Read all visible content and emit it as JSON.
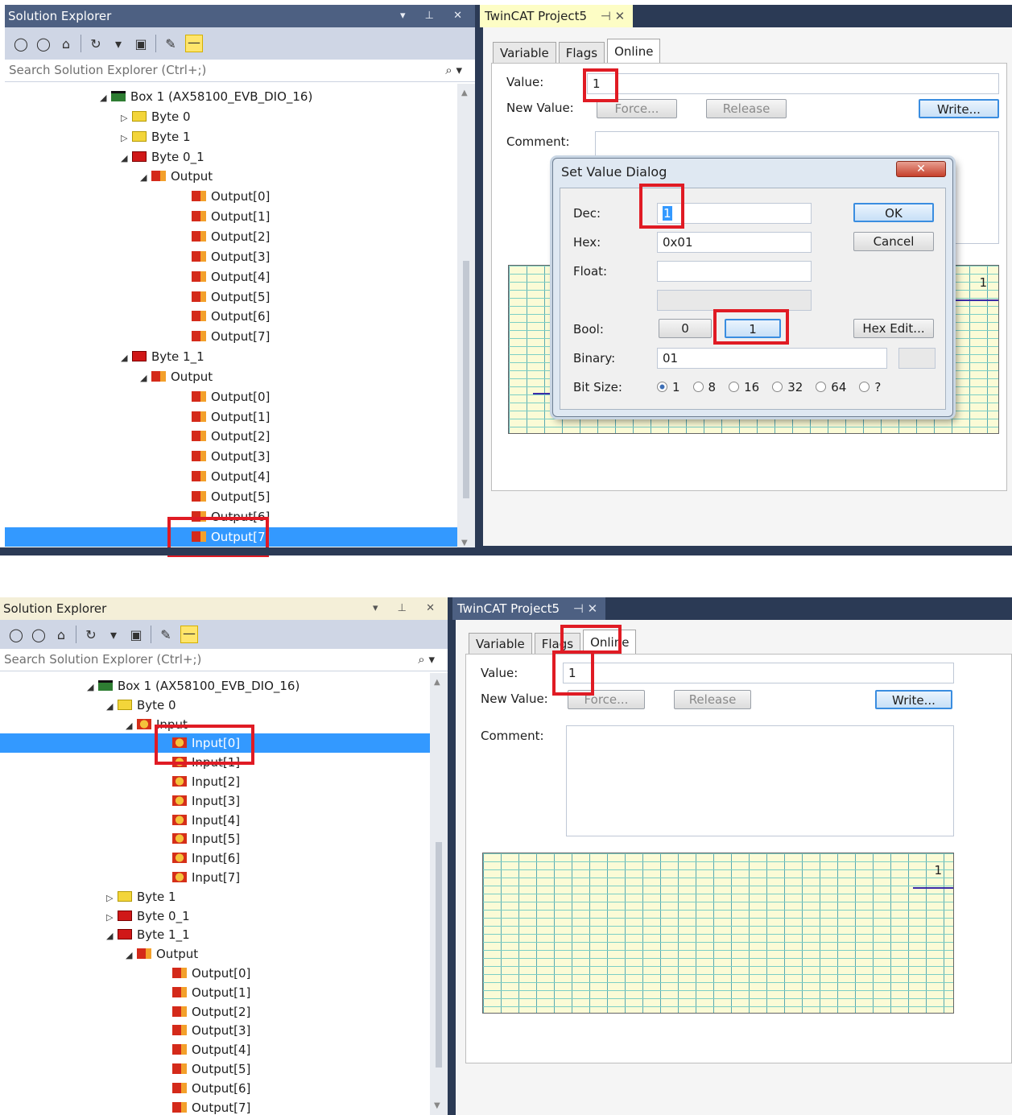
{
  "top": {
    "explorer": {
      "title": "Solution Explorer",
      "title_controls": "▾ ⊥ ✕",
      "search_placeholder": "Search Solution Explorer (Ctrl+;)",
      "tree": [
        {
          "label": "Box 1 (AX58100_EVB_DIO_16)",
          "icon": "device-icon",
          "toggle": "◢"
        },
        {
          "label": "Byte 0",
          "icon": "byte-icon",
          "toggle": "▷"
        },
        {
          "label": "Byte 1",
          "icon": "byte-icon",
          "toggle": "▷"
        },
        {
          "label": "Byte 0_1",
          "icon": "byte-output-icon",
          "toggle": "◢"
        },
        {
          "label": "Output",
          "icon": "output-folder-icon",
          "toggle": "◢"
        },
        {
          "label": "Output[0]",
          "icon": "output-icon"
        },
        {
          "label": "Output[1]",
          "icon": "output-icon"
        },
        {
          "label": "Output[2]",
          "icon": "output-icon"
        },
        {
          "label": "Output[3]",
          "icon": "output-icon"
        },
        {
          "label": "Output[4]",
          "icon": "output-icon"
        },
        {
          "label": "Output[5]",
          "icon": "output-icon"
        },
        {
          "label": "Output[6]",
          "icon": "output-icon"
        },
        {
          "label": "Output[7]",
          "icon": "output-icon"
        },
        {
          "label": "Byte 1_1",
          "icon": "byte-output-icon",
          "toggle": "◢"
        },
        {
          "label": "Output",
          "icon": "output-folder-icon",
          "toggle": "◢"
        },
        {
          "label": "Output[0]",
          "icon": "output-icon"
        },
        {
          "label": "Output[1]",
          "icon": "output-icon"
        },
        {
          "label": "Output[2]",
          "icon": "output-icon"
        },
        {
          "label": "Output[3]",
          "icon": "output-icon"
        },
        {
          "label": "Output[4]",
          "icon": "output-icon"
        },
        {
          "label": "Output[5]",
          "icon": "output-icon"
        },
        {
          "label": "Output[6]",
          "icon": "output-icon"
        },
        {
          "label": "Output[7]",
          "icon": "output-icon",
          "selected": true
        }
      ]
    },
    "doc": {
      "tab_title": "TwinCAT Project5",
      "tab_controls": "⊣ ✕",
      "tabs": [
        "Variable",
        "Flags",
        "Online"
      ],
      "active_tab": "Online",
      "value_label": "Value:",
      "value": "1",
      "new_value_label": "New Value:",
      "force_label": "Force...",
      "release_label": "Release",
      "write_label": "Write...",
      "comment_label": "Comment:",
      "graph_value": "1"
    },
    "dialog": {
      "title": "Set Value Dialog",
      "close_label": "✕",
      "dec_label": "Dec:",
      "dec_value": "1",
      "hex_label": "Hex:",
      "hex_value": "0x01",
      "float_label": "Float:",
      "float_value": "",
      "bool_label": "Bool:",
      "bool_0": "0",
      "bool_1": "1",
      "binary_label": "Binary:",
      "binary_value": "01",
      "bitsize_label": "Bit Size:",
      "bitsizes": [
        "1",
        "8",
        "16",
        "32",
        "64",
        "?"
      ],
      "bitsize_selected": "1",
      "ok_label": "OK",
      "cancel_label": "Cancel",
      "hexedit_label": "Hex Edit..."
    }
  },
  "bottom": {
    "explorer": {
      "title": "Solution Explorer",
      "title_controls": "▾ ⊥ ✕",
      "search_placeholder": "Search Solution Explorer (Ctrl+;)",
      "tree": [
        {
          "label": "Box 1 (AX58100_EVB_DIO_16)",
          "icon": "device-icon",
          "toggle": "◢"
        },
        {
          "label": "Byte 0",
          "icon": "byte-icon",
          "toggle": "◢"
        },
        {
          "label": "Input",
          "icon": "input-folder-icon",
          "toggle": "◢"
        },
        {
          "label": "Input[0]",
          "icon": "input-icon",
          "selected": true
        },
        {
          "label": "Input[1]",
          "icon": "input-icon"
        },
        {
          "label": "Input[2]",
          "icon": "input-icon"
        },
        {
          "label": "Input[3]",
          "icon": "input-icon"
        },
        {
          "label": "Input[4]",
          "icon": "input-icon"
        },
        {
          "label": "Input[5]",
          "icon": "input-icon"
        },
        {
          "label": "Input[6]",
          "icon": "input-icon"
        },
        {
          "label": "Input[7]",
          "icon": "input-icon"
        },
        {
          "label": "Byte 1",
          "icon": "byte-icon",
          "toggle": "▷"
        },
        {
          "label": "Byte 0_1",
          "icon": "byte-output-icon",
          "toggle": "▷"
        },
        {
          "label": "Byte 1_1",
          "icon": "byte-output-icon",
          "toggle": "◢"
        },
        {
          "label": "Output",
          "icon": "output-folder-icon",
          "toggle": "◢"
        },
        {
          "label": "Output[0]",
          "icon": "output-icon"
        },
        {
          "label": "Output[1]",
          "icon": "output-icon"
        },
        {
          "label": "Output[2]",
          "icon": "output-icon"
        },
        {
          "label": "Output[3]",
          "icon": "output-icon"
        },
        {
          "label": "Output[4]",
          "icon": "output-icon"
        },
        {
          "label": "Output[5]",
          "icon": "output-icon"
        },
        {
          "label": "Output[6]",
          "icon": "output-icon"
        },
        {
          "label": "Output[7]",
          "icon": "output-icon"
        }
      ]
    },
    "doc": {
      "tab_title": "TwinCAT Project5",
      "tab_controls": "⊣ ✕",
      "tabs": [
        "Variable",
        "Flags",
        "Online"
      ],
      "active_tab": "Online",
      "value_label": "Value:",
      "value": "1",
      "new_value_label": "New Value:",
      "force_label": "Force...",
      "release_label": "Release",
      "write_label": "Write...",
      "comment_label": "Comment:",
      "graph_value": "1"
    }
  },
  "colors": {
    "title_bar": "#4d6082",
    "frame": "#2b3a55",
    "highlight": "#e01b24",
    "selection": "#3399ff",
    "graph_bg": "#fbfbd6"
  }
}
